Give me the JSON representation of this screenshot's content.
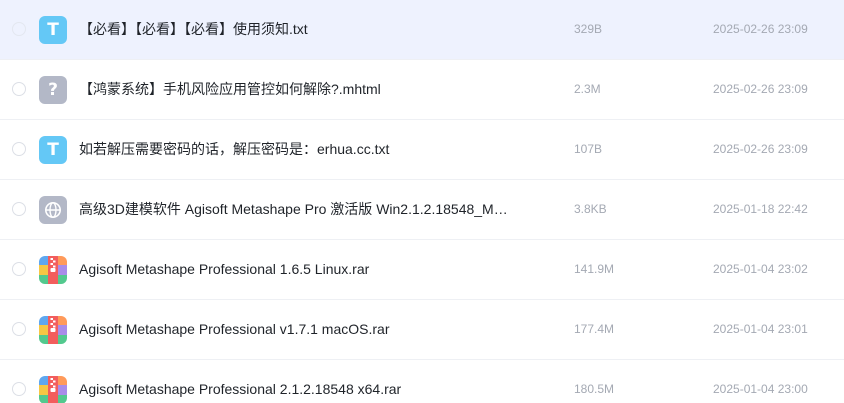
{
  "files": [
    {
      "icon_type": "txt",
      "icon_glyph": "T",
      "name": "【必看】【必看】【必看】使用须知.txt",
      "size": "329B",
      "date": "2025-02-26 23:09",
      "selected": true
    },
    {
      "icon_type": "unknown",
      "icon_glyph": "?",
      "name": "【鸿蒙系统】手机风险应用管控如何解除?.mhtml",
      "size": "2.3M",
      "date": "2025-02-26 23:09",
      "selected": false
    },
    {
      "icon_type": "txt",
      "icon_glyph": "T",
      "name": "如若解压需要密码的话，解压密码是：erhua.cc.txt",
      "size": "107B",
      "date": "2025-02-26 23:09",
      "selected": false
    },
    {
      "icon_type": "web",
      "icon_glyph": "",
      "name": "高级3D建模软件 Agisoft Metashape Pro 激活版 Win2.1.2.18548_Ma...",
      "size": "3.8KB",
      "date": "2025-01-18 22:42",
      "selected": false
    },
    {
      "icon_type": "rar",
      "icon_glyph": "",
      "name": "Agisoft Metashape Professional 1.6.5 Linux.rar",
      "size": "141.9M",
      "date": "2025-01-04 23:02",
      "selected": false
    },
    {
      "icon_type": "rar",
      "icon_glyph": "",
      "name": "Agisoft Metashape Professional v1.7.1 macOS.rar",
      "size": "177.4M",
      "date": "2025-01-04 23:01",
      "selected": false
    },
    {
      "icon_type": "rar",
      "icon_glyph": "",
      "name": "Agisoft Metashape Professional 2.1.2.18548 x64.rar",
      "size": "180.5M",
      "date": "2025-01-04 23:00",
      "selected": false
    }
  ],
  "icon_names": {
    "txt": "text-file-icon",
    "unknown": "unknown-file-icon",
    "web": "web-file-icon",
    "rar": "archive-file-icon"
  },
  "colors": {
    "selected_row": "#eef2fe",
    "txt_icon": "#64c8f6",
    "unknown_icon": "#b3b8c7",
    "meta_text": "#a4a9b3"
  }
}
